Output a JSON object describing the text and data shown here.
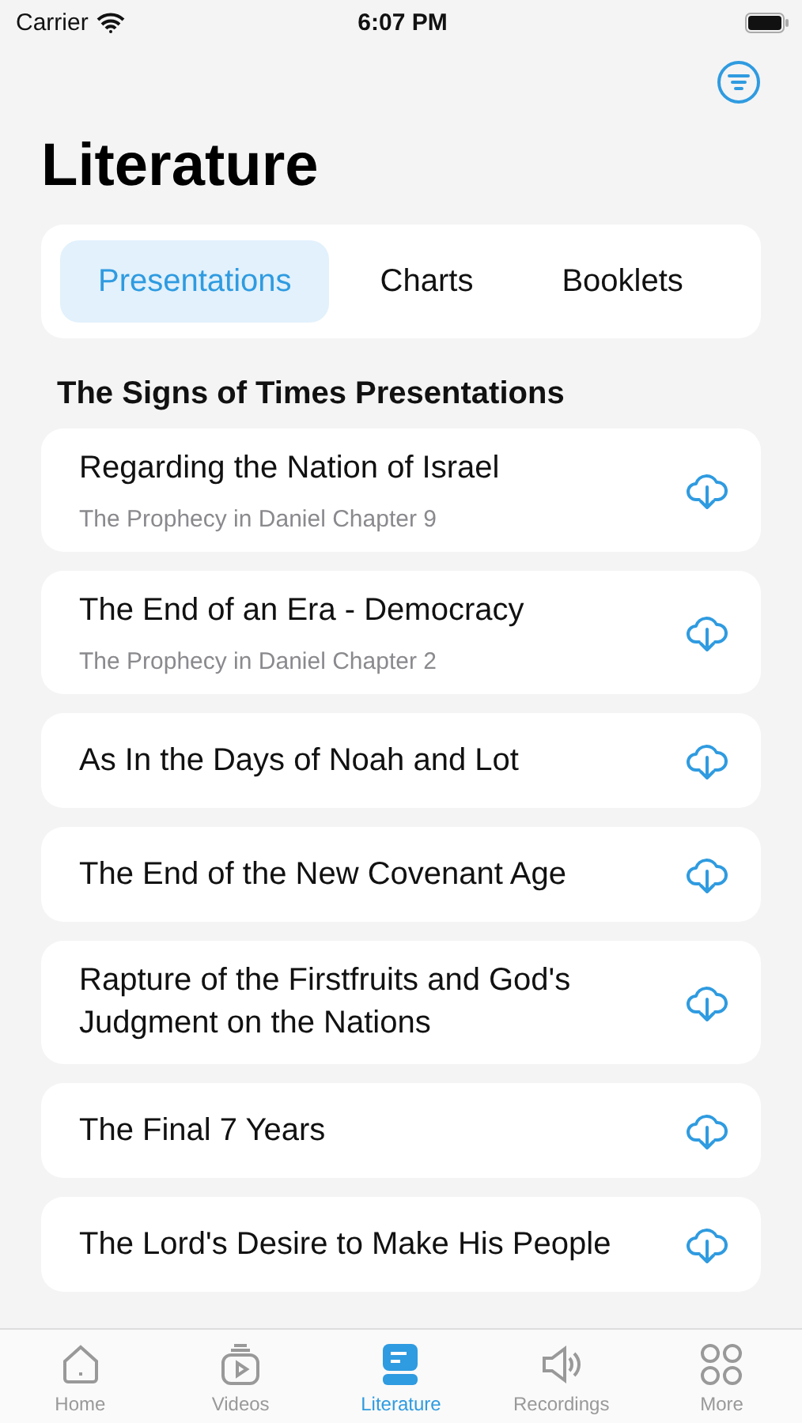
{
  "status_bar": {
    "carrier": "Carrier",
    "time": "6:07 PM"
  },
  "title": "Literature",
  "segments": [
    {
      "label": "Presentations",
      "selected": true
    },
    {
      "label": "Charts",
      "selected": false
    },
    {
      "label": "Booklets",
      "selected": false
    }
  ],
  "section_title": "The Signs of Times Presentations",
  "items": [
    {
      "title": "Regarding the Nation of Israel",
      "subtitle": "The Prophecy in Daniel Chapter 9"
    },
    {
      "title": "The End of an Era - Democracy",
      "subtitle": "The Prophecy in Daniel Chapter 2"
    },
    {
      "title": "As In the Days of Noah and Lot"
    },
    {
      "title": "The End of the New Covenant Age"
    },
    {
      "title": "Rapture of the Firstfruits and God's Judgment on the Nations"
    },
    {
      "title": "The Final 7 Years"
    },
    {
      "title": "The Lord's Desire to Make His People"
    }
  ],
  "tab_bar": [
    {
      "label": "Home",
      "kind": "home",
      "selected": false
    },
    {
      "label": "Videos",
      "kind": "video",
      "selected": false
    },
    {
      "label": "Literature",
      "kind": "book",
      "selected": true
    },
    {
      "label": "Recordings",
      "kind": "speaker",
      "selected": false
    },
    {
      "label": "More",
      "kind": "grid",
      "selected": false
    }
  ]
}
